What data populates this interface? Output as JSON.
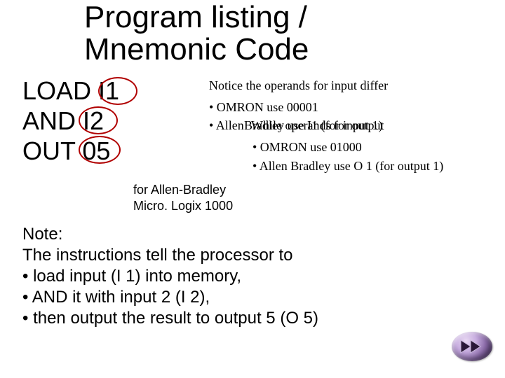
{
  "title_line1": "Program listing /",
  "title_line2": "Mnemonic Code",
  "code": {
    "l1": "LOAD I1",
    "l2": "AND I2",
    "l3": "OUT 05"
  },
  "notice": {
    "header": "Notice the operands for input differ",
    "b1": "• OMRON use 00001",
    "b1a_left": "• Allen",
    "b1a_overlap_a": "While operands for output",
    "b1a_overlap_b": "Bradley use I1 (for input 1)",
    "b2": "• OMRON use 01000",
    "b3": "• Allen Bradley use O 1 (for output 1)"
  },
  "caption": {
    "l1": "for Allen-Bradley",
    "l2": "Micro. Logix 1000"
  },
  "note": {
    "l1": "Note:",
    "l2": "The instructions tell the processor to",
    "l3": "•  load input (I 1) into memory,",
    "l4": "•  AND it with input 2 (I 2),",
    "l5": "•  then output the result to output 5 (O 5)"
  },
  "nav": {
    "name": "next-slide"
  }
}
